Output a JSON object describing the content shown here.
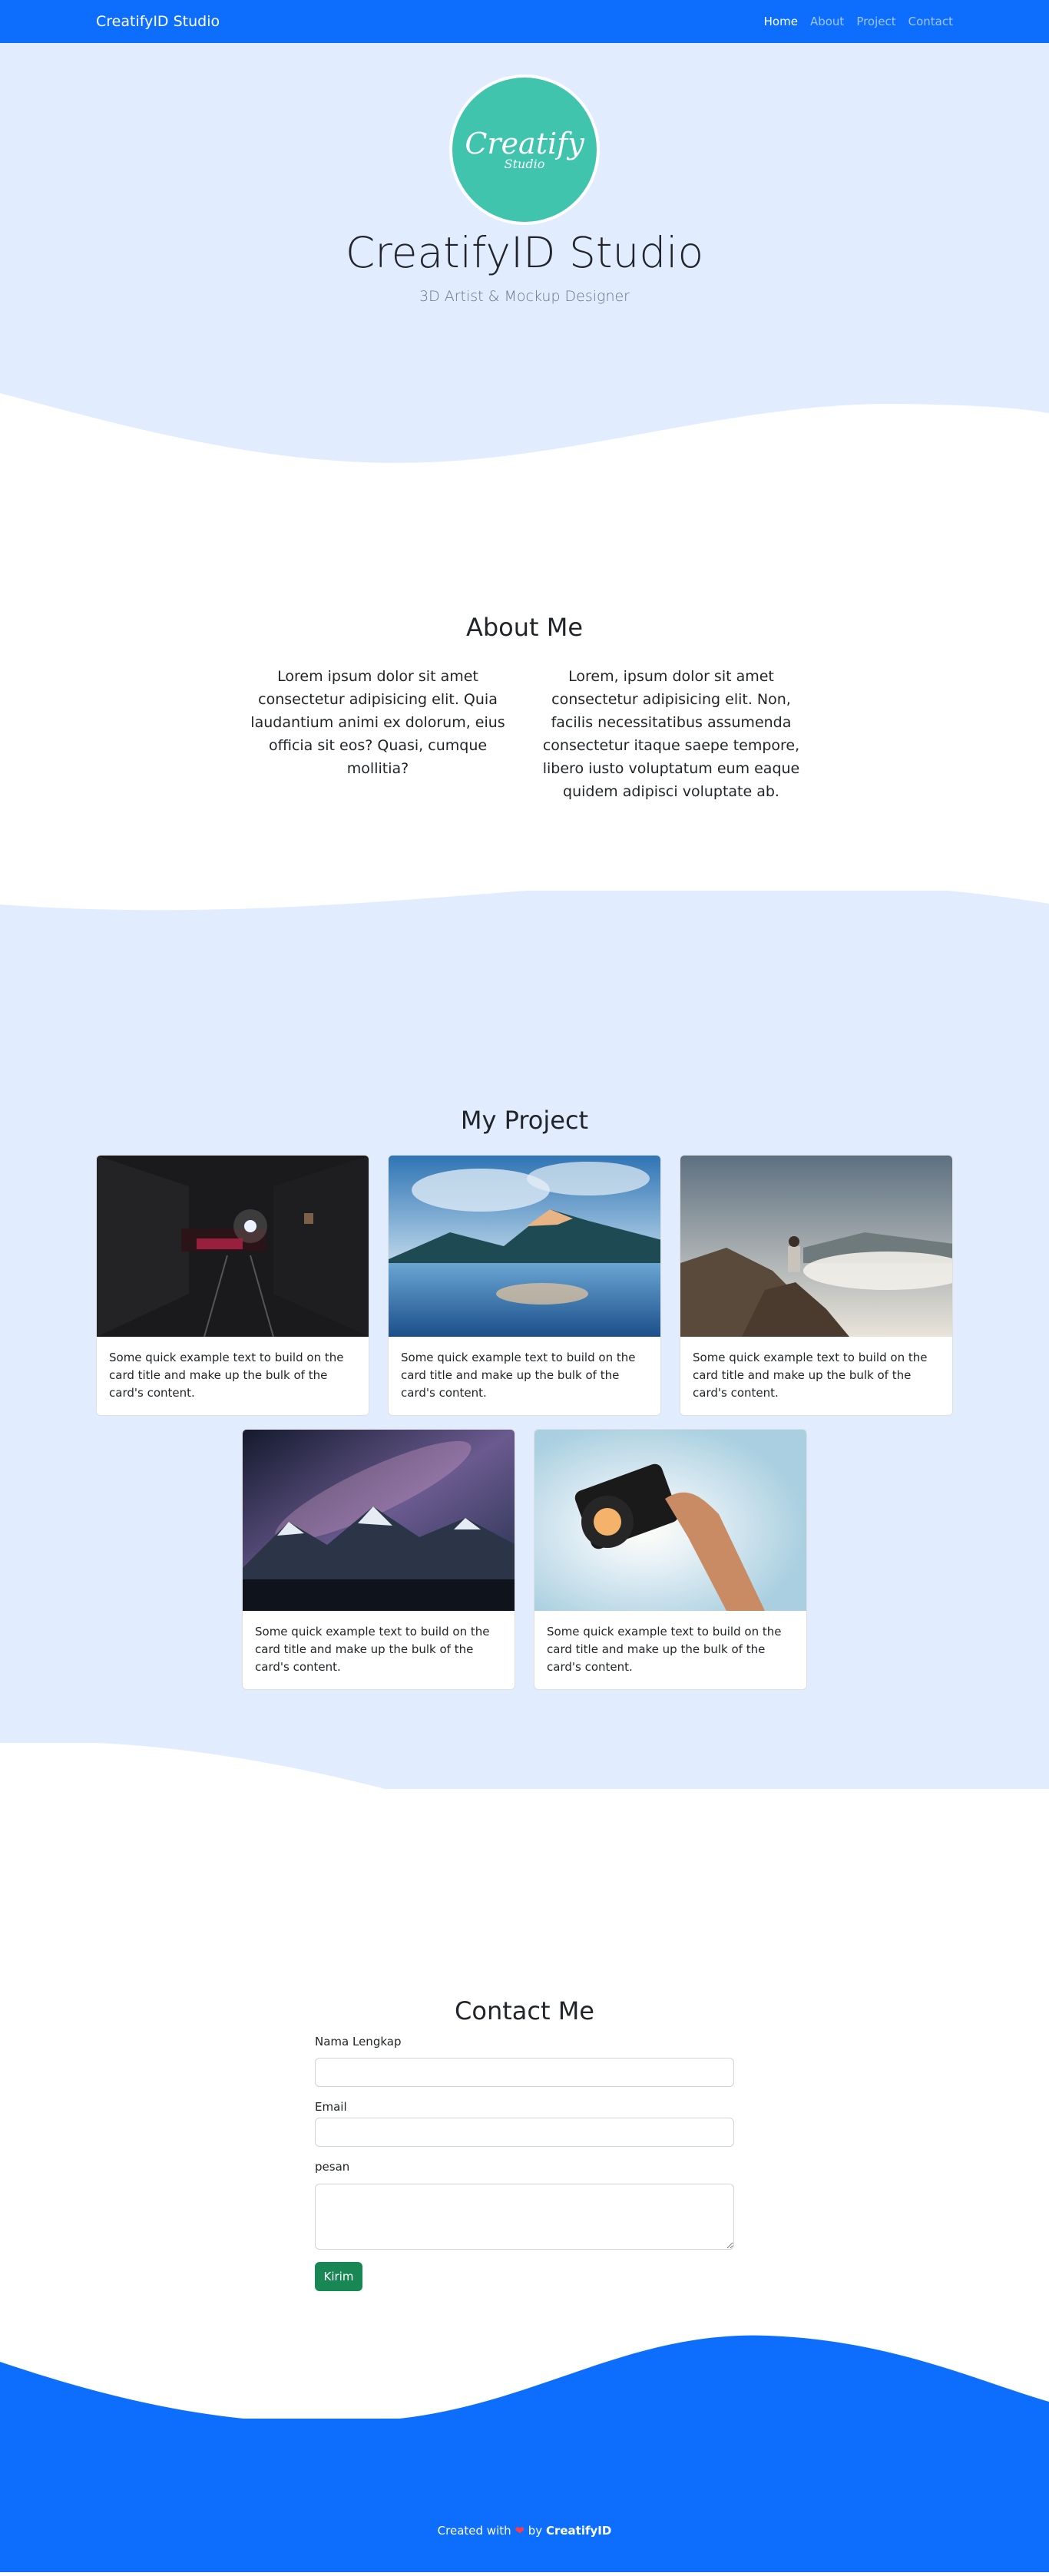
{
  "navbar": {
    "brand": "CreatifyID Studio",
    "links": [
      "Home",
      "About",
      "Project",
      "Contact"
    ]
  },
  "hero": {
    "logo_main": "Creatify",
    "logo_sub": "Studio",
    "title": "CreatifyID Studio",
    "subtitle": "3D Artist & Mockup Designer"
  },
  "about": {
    "title": "About Me",
    "paragraphs": [
      "Lorem ipsum dolor sit amet consectetur adipisicing elit. Quia laudantium animi ex dolorum, eius officia sit eos? Quasi, cumque mollitia?",
      "Lorem, ipsum dolor sit amet consectetur adipisicing elit. Non, facilis necessitatibus assumenda consectetur itaque saepe tempore, libero iusto voluptatum eum eaque quidem adipisci voluptate ab."
    ]
  },
  "projects": {
    "title": "My Project",
    "cards": [
      {
        "text": "Some quick example text to build on the card title and make up the bulk of the card's content.",
        "image": "tunnel-photo"
      },
      {
        "text": "Some quick example text to build on the card title and make up the bulk of the card's content.",
        "image": "lake-mountain-photo"
      },
      {
        "text": "Some quick example text to build on the card title and make up the bulk of the card's content.",
        "image": "photographer-cliff-photo"
      },
      {
        "text": "Some quick example text to build on the card title and make up the bulk of the card's content.",
        "image": "milky-way-mountains-photo"
      },
      {
        "text": "Some quick example text to build on the card title and make up the bulk of the card's content.",
        "image": "camera-in-hand-photo"
      }
    ]
  },
  "contact": {
    "title": "Contact Me",
    "name_label": "Nama Lengkap",
    "email_label": "Email",
    "message_label": "pesan",
    "name_value": "",
    "email_value": "",
    "message_value": "",
    "submit_label": "Kirim"
  },
  "footer": {
    "prefix": "Created with",
    "heart": "❤",
    "by": "by",
    "author": "CreatifyID"
  },
  "colors": {
    "primary": "#0d6efd",
    "section_bg": "#e1ecff",
    "logo_teal": "#40c4ad",
    "success": "#198754"
  }
}
